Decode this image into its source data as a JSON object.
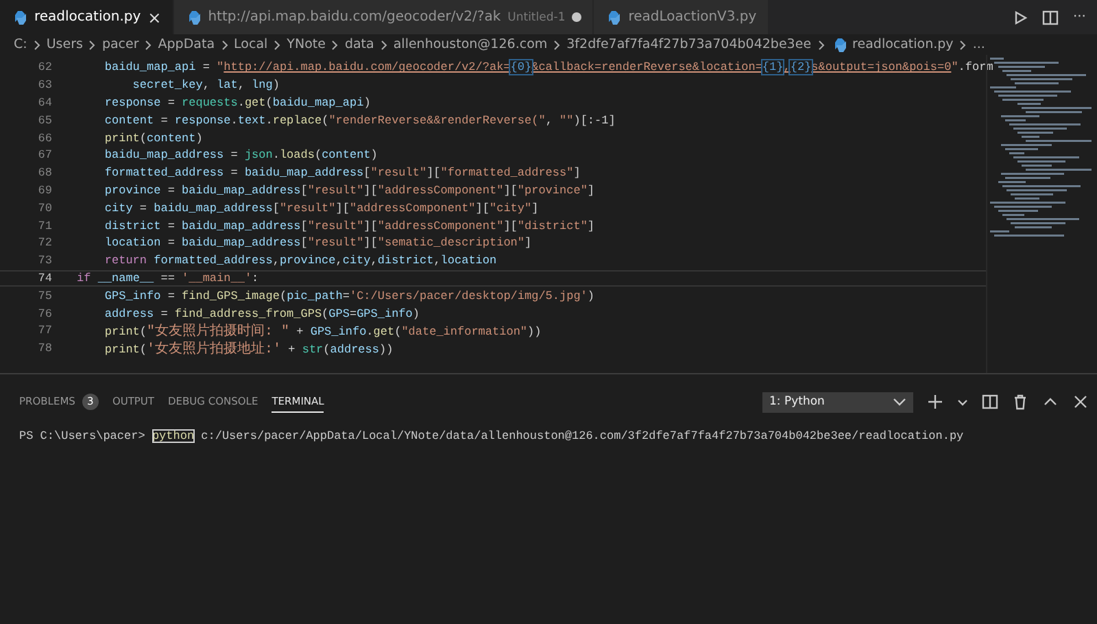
{
  "tabs": [
    {
      "label": "readlocation.py",
      "selected": true,
      "dirty": false,
      "close": "×"
    },
    {
      "label": "http://api.map.baidu.com/geocoder/v2/?ak",
      "description": "Untitled-1",
      "selected": false,
      "dirty": true
    },
    {
      "label": "readLoactionV3.py",
      "selected": false,
      "dirty": false
    }
  ],
  "editor_actions": {
    "more": "···"
  },
  "breadcrumb": [
    {
      "label": "C:",
      "kind": "folder"
    },
    {
      "label": "Users",
      "kind": "folder"
    },
    {
      "label": "pacer",
      "kind": "folder"
    },
    {
      "label": "AppData",
      "kind": "folder"
    },
    {
      "label": "Local",
      "kind": "folder"
    },
    {
      "label": "YNote",
      "kind": "folder"
    },
    {
      "label": "data",
      "kind": "folder"
    },
    {
      "label": "allenhouston@126.com",
      "kind": "folder"
    },
    {
      "label": "3f2dfe7af7fa4f27b73a704b042be3ee",
      "kind": "folder"
    },
    {
      "label": "readlocation.py",
      "kind": "file"
    },
    {
      "label": "...",
      "kind": "symbol"
    }
  ],
  "code": [
    {
      "number": "62",
      "current": false,
      "tokens": [
        {
          "kind": "variable",
          "text": "    baidu_map_api"
        },
        {
          "kind": "plain",
          "text": " = "
        },
        {
          "kind": "string",
          "text": "\""
        },
        {
          "kind": "link",
          "text": "http://api.map.baidu.com/geocoder/v2/?ak="
        },
        {
          "kind": "placeholder",
          "text": "{0}"
        },
        {
          "kind": "link",
          "text": "&callback=renderReverse&location="
        },
        {
          "kind": "placeholder",
          "text": "{1}"
        },
        {
          "kind": "link",
          "text": ","
        },
        {
          "kind": "placeholder",
          "text": "{2}"
        },
        {
          "kind": "link",
          "text": "s&output=json&pois=0"
        },
        {
          "kind": "string",
          "text": "\""
        },
        {
          "kind": "plain",
          "text": ".form"
        }
      ]
    },
    {
      "number": "63",
      "current": false,
      "tokens": [
        {
          "kind": "variable",
          "text": "        secret_key"
        },
        {
          "kind": "plain",
          "text": ", "
        },
        {
          "kind": "variable",
          "text": "lat"
        },
        {
          "kind": "plain",
          "text": ", "
        },
        {
          "kind": "variable",
          "text": "lng"
        },
        {
          "kind": "plain",
          "text": ")"
        }
      ]
    },
    {
      "number": "64",
      "current": false,
      "tokens": [
        {
          "kind": "variable",
          "text": "    response"
        },
        {
          "kind": "plain",
          "text": " = "
        },
        {
          "kind": "module",
          "text": "requests"
        },
        {
          "kind": "plain",
          "text": "."
        },
        {
          "kind": "function",
          "text": "get"
        },
        {
          "kind": "plain",
          "text": "("
        },
        {
          "kind": "variable",
          "text": "baidu_map_api"
        },
        {
          "kind": "plain",
          "text": ")"
        }
      ]
    },
    {
      "number": "65",
      "current": false,
      "tokens": [
        {
          "kind": "variable",
          "text": "    content"
        },
        {
          "kind": "plain",
          "text": " = "
        },
        {
          "kind": "variable",
          "text": "response"
        },
        {
          "kind": "plain",
          "text": "."
        },
        {
          "kind": "variable",
          "text": "text"
        },
        {
          "kind": "plain",
          "text": "."
        },
        {
          "kind": "function",
          "text": "replace"
        },
        {
          "kind": "plain",
          "text": "("
        },
        {
          "kind": "string",
          "text": "\"renderReverse&&renderReverse(\""
        },
        {
          "kind": "plain",
          "text": ", "
        },
        {
          "kind": "string",
          "text": "\"\""
        },
        {
          "kind": "plain",
          "text": ")[:-1]"
        }
      ]
    },
    {
      "number": "66",
      "current": false,
      "tokens": [
        {
          "kind": "function",
          "text": "    print"
        },
        {
          "kind": "plain",
          "text": "("
        },
        {
          "kind": "variable",
          "text": "content"
        },
        {
          "kind": "plain",
          "text": ")"
        }
      ]
    },
    {
      "number": "67",
      "current": false,
      "tokens": [
        {
          "kind": "variable",
          "text": "    baidu_map_address"
        },
        {
          "kind": "plain",
          "text": " = "
        },
        {
          "kind": "module",
          "text": "json"
        },
        {
          "kind": "plain",
          "text": "."
        },
        {
          "kind": "function",
          "text": "loads"
        },
        {
          "kind": "plain",
          "text": "("
        },
        {
          "kind": "variable",
          "text": "content"
        },
        {
          "kind": "plain",
          "text": ")"
        }
      ]
    },
    {
      "number": "68",
      "current": false,
      "tokens": [
        {
          "kind": "variable",
          "text": "    formatted_address"
        },
        {
          "kind": "plain",
          "text": " = "
        },
        {
          "kind": "variable",
          "text": "baidu_map_address"
        },
        {
          "kind": "plain",
          "text": "["
        },
        {
          "kind": "string",
          "text": "\"result\""
        },
        {
          "kind": "plain",
          "text": "]["
        },
        {
          "kind": "string",
          "text": "\"formatted_address\""
        },
        {
          "kind": "plain",
          "text": "]"
        }
      ]
    },
    {
      "number": "69",
      "current": false,
      "tokens": [
        {
          "kind": "variable",
          "text": "    province"
        },
        {
          "kind": "plain",
          "text": " = "
        },
        {
          "kind": "variable",
          "text": "baidu_map_address"
        },
        {
          "kind": "plain",
          "text": "["
        },
        {
          "kind": "string",
          "text": "\"result\""
        },
        {
          "kind": "plain",
          "text": "]["
        },
        {
          "kind": "string",
          "text": "\"addressComponent\""
        },
        {
          "kind": "plain",
          "text": "]["
        },
        {
          "kind": "string",
          "text": "\"province\""
        },
        {
          "kind": "plain",
          "text": "]"
        }
      ]
    },
    {
      "number": "70",
      "current": false,
      "tokens": [
        {
          "kind": "variable",
          "text": "    city"
        },
        {
          "kind": "plain",
          "text": " = "
        },
        {
          "kind": "variable",
          "text": "baidu_map_address"
        },
        {
          "kind": "plain",
          "text": "["
        },
        {
          "kind": "string",
          "text": "\"result\""
        },
        {
          "kind": "plain",
          "text": "]["
        },
        {
          "kind": "string",
          "text": "\"addressComponent\""
        },
        {
          "kind": "plain",
          "text": "]["
        },
        {
          "kind": "string",
          "text": "\"city\""
        },
        {
          "kind": "plain",
          "text": "]"
        }
      ]
    },
    {
      "number": "71",
      "current": false,
      "tokens": [
        {
          "kind": "variable",
          "text": "    district"
        },
        {
          "kind": "plain",
          "text": " = "
        },
        {
          "kind": "variable",
          "text": "baidu_map_address"
        },
        {
          "kind": "plain",
          "text": "["
        },
        {
          "kind": "string",
          "text": "\"result\""
        },
        {
          "kind": "plain",
          "text": "]["
        },
        {
          "kind": "string",
          "text": "\"addressComponent\""
        },
        {
          "kind": "plain",
          "text": "]["
        },
        {
          "kind": "string",
          "text": "\"district\""
        },
        {
          "kind": "plain",
          "text": "]"
        }
      ]
    },
    {
      "number": "72",
      "current": false,
      "tokens": [
        {
          "kind": "variable",
          "text": "    location"
        },
        {
          "kind": "plain",
          "text": " = "
        },
        {
          "kind": "variable",
          "text": "baidu_map_address"
        },
        {
          "kind": "plain",
          "text": "["
        },
        {
          "kind": "string",
          "text": "\"result\""
        },
        {
          "kind": "plain",
          "text": "]["
        },
        {
          "kind": "string",
          "text": "\"sematic_description\""
        },
        {
          "kind": "plain",
          "text": "]"
        }
      ]
    },
    {
      "number": "73",
      "current": false,
      "tokens": [
        {
          "kind": "keyword",
          "text": "    return "
        },
        {
          "kind": "variable",
          "text": "formatted_address"
        },
        {
          "kind": "plain",
          "text": ","
        },
        {
          "kind": "variable",
          "text": "province"
        },
        {
          "kind": "plain",
          "text": ","
        },
        {
          "kind": "variable",
          "text": "city"
        },
        {
          "kind": "plain",
          "text": ","
        },
        {
          "kind": "variable",
          "text": "district"
        },
        {
          "kind": "plain",
          "text": ","
        },
        {
          "kind": "variable",
          "text": "location"
        }
      ]
    },
    {
      "number": "74",
      "current": true,
      "tokens": [
        {
          "kind": "keyword",
          "text": "if "
        },
        {
          "kind": "variable",
          "text": "__name__"
        },
        {
          "kind": "plain",
          "text": " == "
        },
        {
          "kind": "string",
          "text": "'__main__'"
        },
        {
          "kind": "plain",
          "text": ":"
        }
      ]
    },
    {
      "number": "75",
      "current": false,
      "tokens": [
        {
          "kind": "variable",
          "text": "    GPS_info"
        },
        {
          "kind": "plain",
          "text": " = "
        },
        {
          "kind": "function",
          "text": "find_GPS_image"
        },
        {
          "kind": "plain",
          "text": "("
        },
        {
          "kind": "variable",
          "text": "pic_path"
        },
        {
          "kind": "plain",
          "text": "="
        },
        {
          "kind": "string",
          "text": "'C:/Users/pacer/desktop/img/5.jpg'"
        },
        {
          "kind": "plain",
          "text": ")"
        }
      ]
    },
    {
      "number": "76",
      "current": false,
      "tokens": [
        {
          "kind": "variable",
          "text": "    address"
        },
        {
          "kind": "plain",
          "text": " = "
        },
        {
          "kind": "function",
          "text": "find_address_from_GPS"
        },
        {
          "kind": "plain",
          "text": "("
        },
        {
          "kind": "variable",
          "text": "GPS"
        },
        {
          "kind": "plain",
          "text": "="
        },
        {
          "kind": "variable",
          "text": "GPS_info"
        },
        {
          "kind": "plain",
          "text": ")"
        }
      ]
    },
    {
      "number": "77",
      "current": false,
      "tokens": [
        {
          "kind": "function",
          "text": "    print"
        },
        {
          "kind": "plain",
          "text": "("
        },
        {
          "kind": "cjkstring",
          "text": "\"女友照片拍摄时间: \""
        },
        {
          "kind": "plain",
          "text": " + "
        },
        {
          "kind": "variable",
          "text": "GPS_info"
        },
        {
          "kind": "plain",
          "text": "."
        },
        {
          "kind": "function",
          "text": "get"
        },
        {
          "kind": "plain",
          "text": "("
        },
        {
          "kind": "string",
          "text": "\"date_information\""
        },
        {
          "kind": "plain",
          "text": "))"
        }
      ]
    },
    {
      "number": "78",
      "current": false,
      "tokens": [
        {
          "kind": "function",
          "text": "    print"
        },
        {
          "kind": "plain",
          "text": "("
        },
        {
          "kind": "cjkstring",
          "text": "'女友照片拍摄地址:'"
        },
        {
          "kind": "plain",
          "text": " + "
        },
        {
          "kind": "module",
          "text": "str"
        },
        {
          "kind": "plain",
          "text": "("
        },
        {
          "kind": "variable",
          "text": "address"
        },
        {
          "kind": "plain",
          "text": "))"
        }
      ]
    }
  ],
  "panel": {
    "tabs": [
      {
        "label": "PROBLEMS",
        "badge": "3",
        "selected": false
      },
      {
        "label": "OUTPUT",
        "selected": false
      },
      {
        "label": "DEBUG CONSOLE",
        "selected": false
      },
      {
        "label": "TERMINAL",
        "selected": true
      }
    ],
    "terminal_select": "1: Python",
    "terminal": {
      "prompt": "PS C:\\Users\\pacer>",
      "command": "python",
      "args": "c:/Users/pacer/AppData/Local/YNote/data/allenhouston@126.com/3f2dfe7af7fa4f27b73a704b042be3ee/readlocation.py"
    }
  }
}
